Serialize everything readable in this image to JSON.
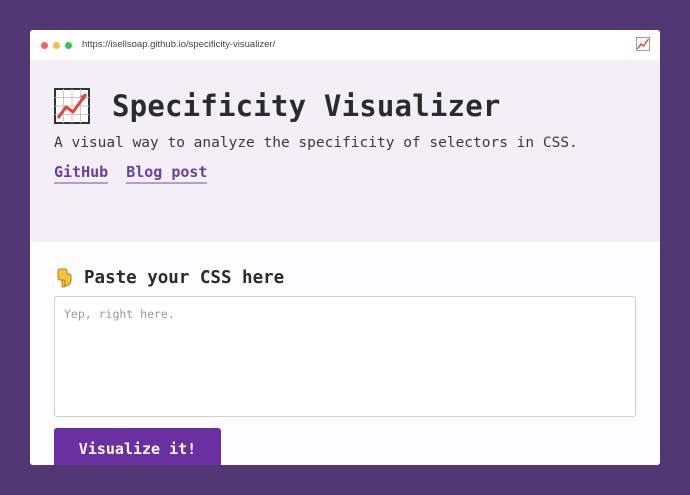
{
  "browser": {
    "url": "https://isellsoap.github.io/specificity-visualizer/"
  },
  "header": {
    "logo_icon": "chart-increasing-icon",
    "title": "Specificity Visualizer",
    "subtitle": "A visual way to analyze the specificity of selectors in CSS.",
    "links": [
      {
        "label": "GitHub"
      },
      {
        "label": "Blog post"
      }
    ]
  },
  "main": {
    "section_icon": "backhand-index-pointing-down-icon",
    "section_title": "Paste your CSS here",
    "input": {
      "value": "",
      "placeholder": "Yep, right here."
    },
    "submit_label": "Visualize it!"
  },
  "colors": {
    "page_background": "#513774",
    "hero_background": "#f2eff7",
    "accent": "#6a2fa0",
    "link": "#6a3f9e"
  }
}
